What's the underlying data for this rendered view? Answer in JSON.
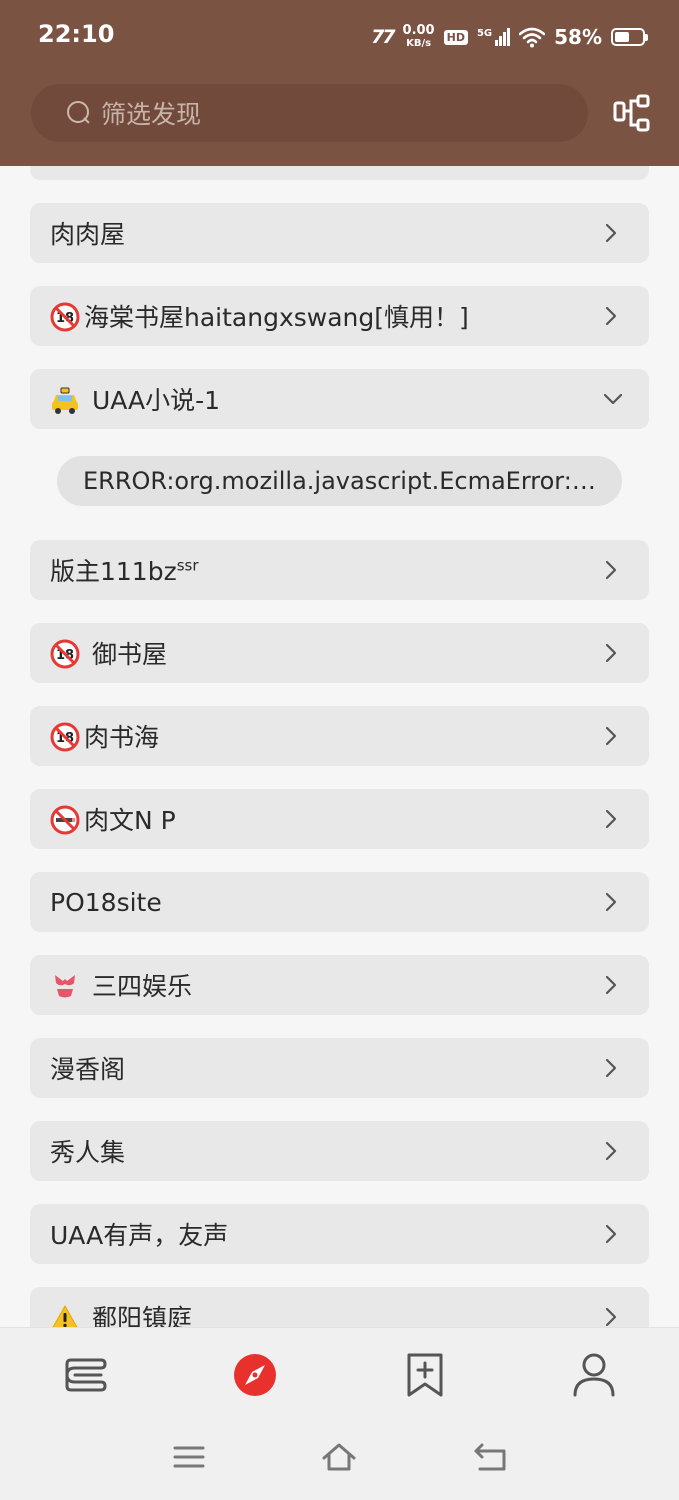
{
  "status_bar": {
    "time": "22:10",
    "brand": "77",
    "speed_value": "0.00",
    "speed_unit": "KB/s",
    "hd": "HD",
    "network": "5G",
    "battery": "58%"
  },
  "search": {
    "placeholder": "筛选发现"
  },
  "items": [
    {
      "label": "肉肉屋",
      "icon": ""
    },
    {
      "label": "海棠书屋haitangxswang[慎用！]",
      "icon": "no-under-18-icon"
    },
    {
      "label": " UAA小说-1",
      "icon": "taxi-icon",
      "expanded": true
    },
    {
      "label": "版主111bz",
      "sup": "ssr",
      "icon": ""
    },
    {
      "label": " 御书屋",
      "icon": "no-under-18-icon"
    },
    {
      "label": "肉书海",
      "icon": "no-under-18-icon"
    },
    {
      "label": "肉文N P",
      "icon": "no-smoking-icon"
    },
    {
      "label": "PO18site",
      "icon": ""
    },
    {
      "label": " 三四娱乐",
      "icon": "bikini-icon"
    },
    {
      "label": "漫香阁",
      "icon": ""
    },
    {
      "label": "秀人集",
      "icon": ""
    },
    {
      "label": "UAA有声，友声",
      "icon": ""
    },
    {
      "label": " 鄱阳镇庭",
      "icon": "warning-icon"
    }
  ],
  "error": {
    "text": "ERROR:org.mozilla.javascript.EcmaError:…"
  },
  "bottom_nav": [
    "bookshelf-icon",
    "explore-icon",
    "bookmark-add-icon",
    "profile-icon"
  ],
  "colors": {
    "app_bar": "#7b5343",
    "accent": "#e8302c",
    "item_bg": "#e8e8e8"
  }
}
